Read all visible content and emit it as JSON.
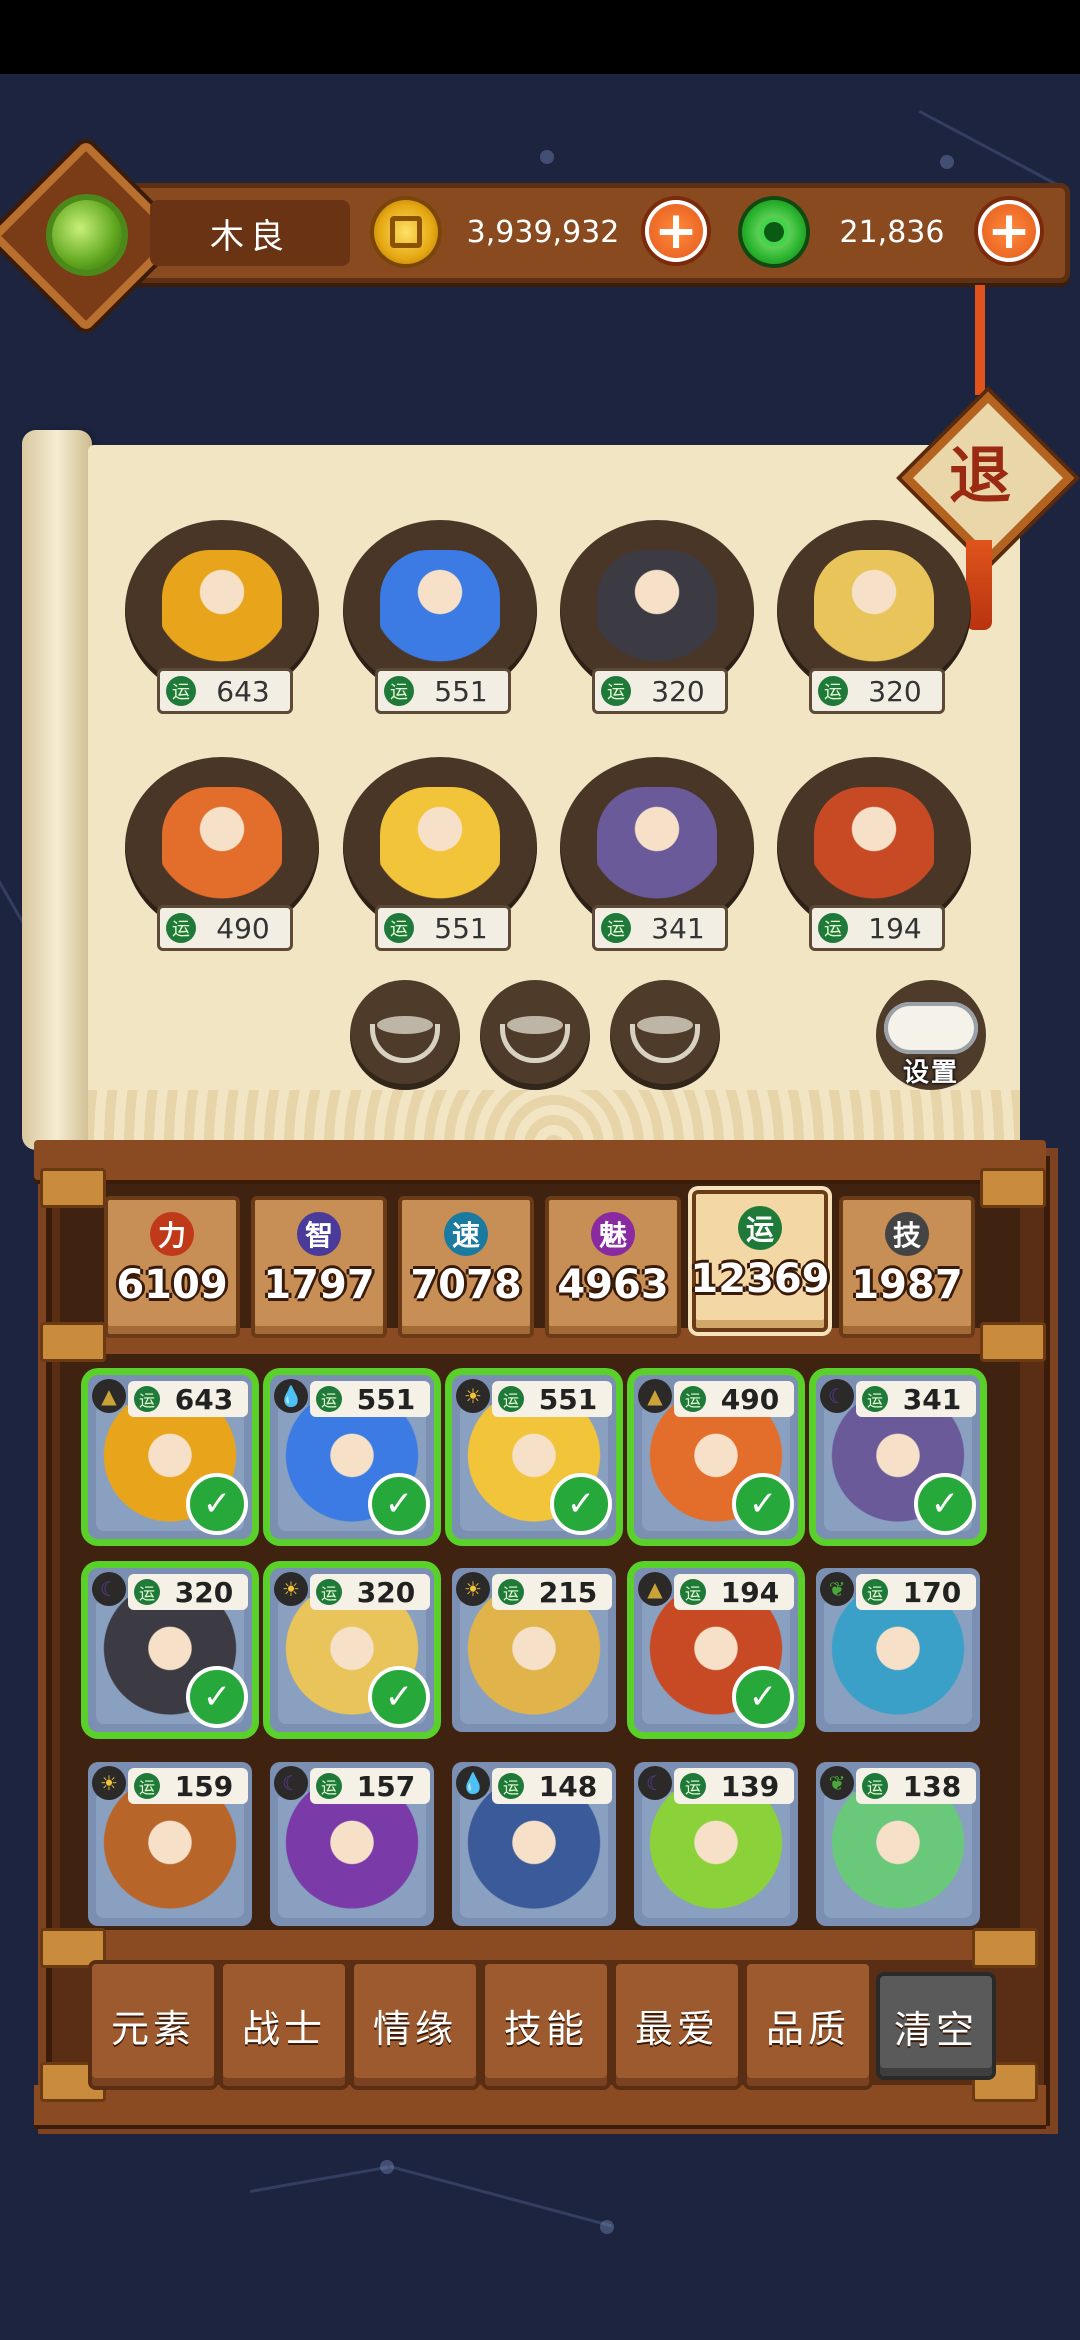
{
  "player": {
    "name": "木良",
    "gold": "3,939,932",
    "jade": "21,836"
  },
  "exit_label": "退",
  "settings_label": "设置",
  "team": [
    {
      "name": "hero-1",
      "value": "643",
      "color": "#e8a41b"
    },
    {
      "name": "hero-2",
      "value": "551",
      "color": "#3b7be3"
    },
    {
      "name": "hero-3",
      "value": "320",
      "color": "#3c3a42"
    },
    {
      "name": "hero-4",
      "value": "320",
      "color": "#e8c45a"
    },
    {
      "name": "hero-5",
      "value": "490",
      "color": "#e36d2b"
    },
    {
      "name": "hero-6",
      "value": "551",
      "color": "#f2c43a"
    },
    {
      "name": "hero-7",
      "value": "341",
      "color": "#6a5a9a"
    },
    {
      "name": "hero-8",
      "value": "194",
      "color": "#c84a24"
    }
  ],
  "stat_icon_label": "运",
  "stats": [
    {
      "label": "力",
      "value": "6109",
      "color": "#c03a1a"
    },
    {
      "label": "智",
      "value": "1797",
      "color": "#4a3a9a"
    },
    {
      "label": "速",
      "value": "7078",
      "color": "#1a7aa0"
    },
    {
      "label": "魅",
      "value": "4963",
      "color": "#8a2aa0"
    },
    {
      "label": "运",
      "value": "12369",
      "color": "#1f7a3a"
    },
    {
      "label": "技",
      "value": "1987",
      "color": "#444444"
    }
  ],
  "cards": [
    {
      "value": "643",
      "elem": "earth",
      "selected": true,
      "color": "#e8a41b"
    },
    {
      "value": "551",
      "elem": "water",
      "selected": true,
      "color": "#3b7be3"
    },
    {
      "value": "551",
      "elem": "light",
      "selected": true,
      "color": "#f2c43a"
    },
    {
      "value": "490",
      "elem": "earth",
      "selected": true,
      "color": "#e36d2b"
    },
    {
      "value": "341",
      "elem": "dark",
      "selected": true,
      "color": "#6a5a9a"
    },
    {
      "value": "320",
      "elem": "dark",
      "selected": true,
      "color": "#3c3a42"
    },
    {
      "value": "320",
      "elem": "light",
      "selected": true,
      "color": "#e8c45a"
    },
    {
      "value": "215",
      "elem": "light",
      "selected": false,
      "color": "#e0b44a"
    },
    {
      "value": "194",
      "elem": "earth",
      "selected": true,
      "color": "#c84a24"
    },
    {
      "value": "170",
      "elem": "wood",
      "selected": false,
      "color": "#3aa0c8"
    },
    {
      "value": "159",
      "elem": "light",
      "selected": false,
      "color": "#b8652a"
    },
    {
      "value": "157",
      "elem": "dark",
      "selected": false,
      "color": "#7a3aa8"
    },
    {
      "value": "148",
      "elem": "water",
      "selected": false,
      "color": "#3a5a9a"
    },
    {
      "value": "139",
      "elem": "dark",
      "selected": false,
      "color": "#8ad13a"
    },
    {
      "value": "138",
      "elem": "wood",
      "selected": false,
      "color": "#6ac87a"
    }
  ],
  "filters": [
    "元素",
    "战士",
    "情缘",
    "技能",
    "最爱",
    "品质"
  ],
  "clear_label": "清空"
}
